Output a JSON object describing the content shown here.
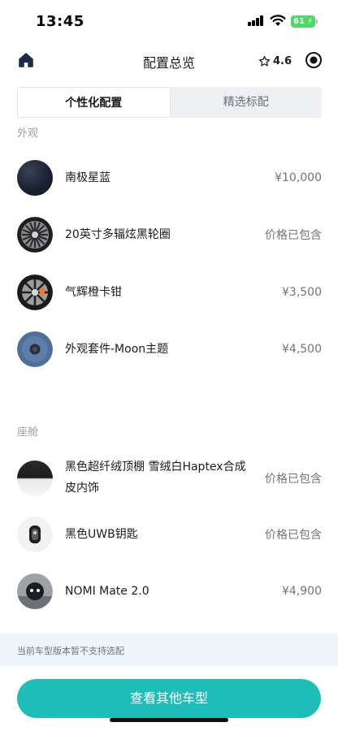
{
  "status_bar": {
    "time": "13:45",
    "battery": "61"
  },
  "header": {
    "title": "配置总览",
    "rating": "4.6"
  },
  "tabs": [
    {
      "label": "个性化配置",
      "active": true
    },
    {
      "label": "精选标配",
      "active": false
    }
  ],
  "sections": {
    "exterior": {
      "label": "外观",
      "items": [
        {
          "name": "南极星蓝",
          "price": "¥10,000",
          "thumb": "dark-blue-swatch"
        },
        {
          "name": "20英寸多辐炫黑轮圈",
          "price": "价格已包含",
          "thumb": "wheel"
        },
        {
          "name": "气辉橙卡钳",
          "price": "¥3,500",
          "thumb": "wheel-orange-caliper"
        },
        {
          "name": "外观套件-Moon主题",
          "price": "¥4,500",
          "thumb": "moon-theme"
        }
      ]
    },
    "cabin": {
      "label": "座舱",
      "items": [
        {
          "name_line1": "黑色超纤绒顶棚 雪绒白Haptex合成",
          "name_line2": "皮内饰",
          "price": "价格已包含",
          "thumb": "black-white-swatch"
        },
        {
          "name": "黑色UWB钥匙",
          "price": "价格已包含",
          "thumb": "key"
        },
        {
          "name": "NOMI Mate 2.0",
          "price": "¥4,900",
          "thumb": "nomi"
        }
      ]
    }
  },
  "notice": "当前车型版本暂不支持选配",
  "cta_label": "查看其他车型",
  "colors": {
    "accent": "#1fbdb8",
    "nav_icon": "#1a2a4a"
  }
}
